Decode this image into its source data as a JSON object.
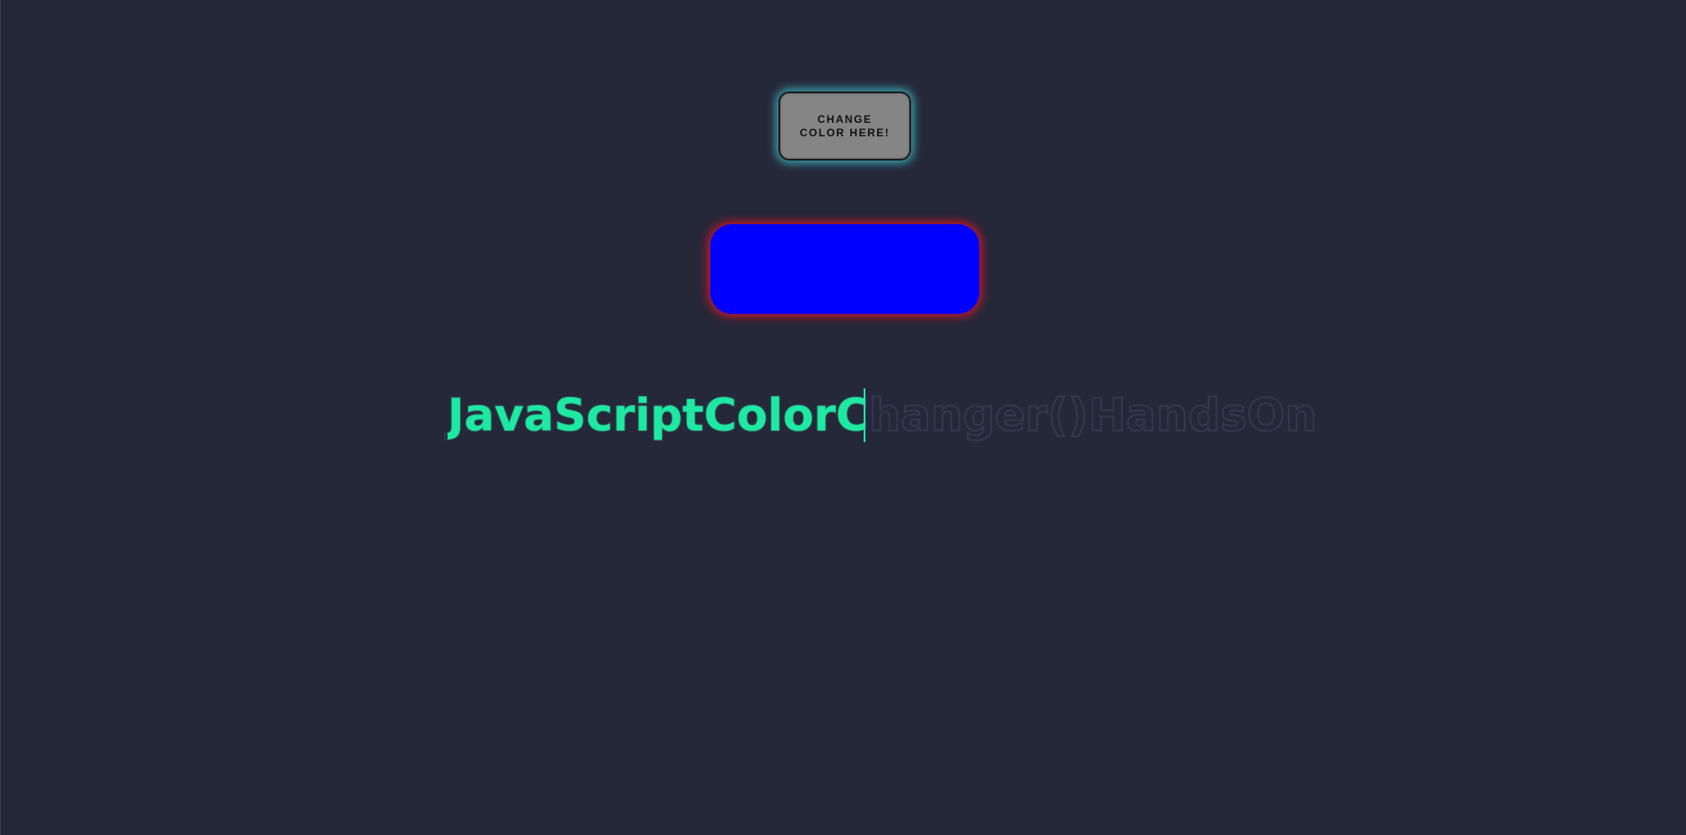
{
  "button": {
    "label": "Change color here!"
  },
  "color_box": {
    "fill_color": "#0000ff",
    "glow_color": "#e61428"
  },
  "headline": {
    "text": "JavaScriptColorChanger()HandsOn",
    "typed_color": "#1de9a0",
    "outline_color": "#35384c"
  },
  "colors": {
    "background": "#252839",
    "button_glow": "#40d0d6"
  }
}
